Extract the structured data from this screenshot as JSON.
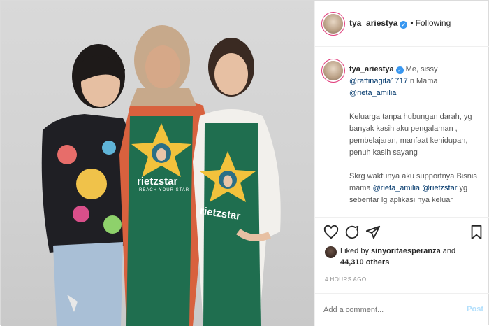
{
  "header": {
    "username": "tya_ariestya",
    "separator": "•",
    "follow_status": "Following"
  },
  "caption": {
    "username": "tya_ariestya",
    "intro": "Me, sissy",
    "mention1": "@raffinagita1717",
    "connector": "n Mama",
    "mention2": "@rieta_amilia",
    "para2": "Keluarga tanpa hubungan darah, yg banyak kasih aku pengalaman , pembelajaran, manfaat kehidupan, penuh kasih sayang",
    "para3_a": "Skrg waktunya aku supportnya Bisnis mama",
    "para3_m1": "@rieta_amilia",
    "para3_m2": "@rietzstar",
    "para3_b": "yg sebentar lg aplikasi nya keluar"
  },
  "likes": {
    "prefix": "Liked by",
    "user": "sinyoritaesperanza",
    "and": "and",
    "count": "44,310 others"
  },
  "timestamp": "4 HOURS AGO",
  "comment": {
    "placeholder": "Add a comment...",
    "post_label": "Post"
  },
  "photo": {
    "brand": "rietzstar",
    "tagline": "REACH YOUR STAR"
  },
  "icons": [
    "heart-icon",
    "comment-icon",
    "share-icon",
    "bookmark-icon",
    "verified-icon"
  ],
  "colors": {
    "link": "#00376b",
    "verified": "#3897f0",
    "post_disabled": "#b2dffc",
    "apron": "#1f6e4f"
  }
}
